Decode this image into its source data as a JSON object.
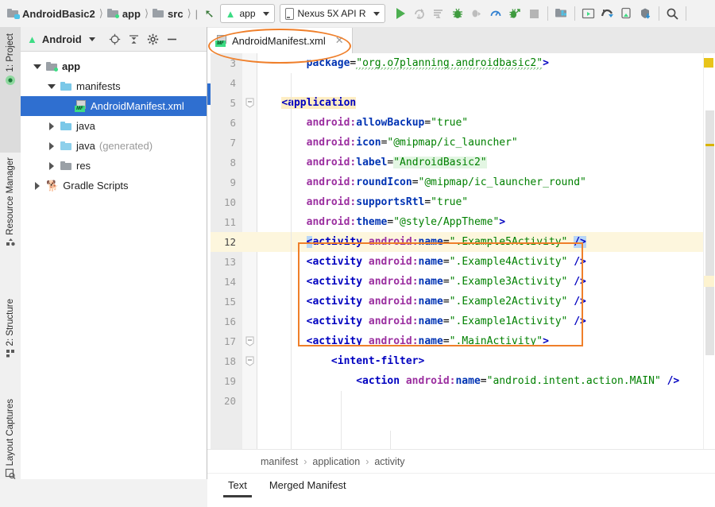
{
  "window": {
    "app": "Android Studio",
    "breadcrumb": [
      {
        "label": "AndroidBasic2",
        "icon": "project-folder-icon"
      },
      {
        "label": "app",
        "icon": "module-folder-icon"
      },
      {
        "label": "src",
        "icon": "folder-icon"
      }
    ]
  },
  "toolbar": {
    "build_icon": "hammer-icon",
    "run_config": {
      "label": "app",
      "icon": "android-head-icon",
      "caret": "chevron-down-icon"
    },
    "device": {
      "label": "Nexus 5X API R",
      "icon": "phone-icon",
      "caret": "chevron-down-icon"
    },
    "actions": [
      {
        "name": "run-button",
        "icon": "play-icon"
      },
      {
        "name": "apply-changes-button",
        "icon": "apply-changes-icon"
      },
      {
        "name": "apply-code-changes-button",
        "icon": "apply-code-changes-icon"
      },
      {
        "name": "debug-button",
        "icon": "bug-icon"
      },
      {
        "name": "attach-debugger-button",
        "icon": "attach-debugger-icon"
      },
      {
        "name": "profile-button",
        "icon": "gauge-icon"
      },
      {
        "name": "run-with-coverage-button",
        "icon": "bug-run-icon"
      },
      {
        "name": "stop-button",
        "icon": "stop-icon"
      },
      {
        "name": "sync-gradle-button",
        "icon": "gradle-sync-icon"
      },
      {
        "name": "avd-manager-button",
        "icon": "avd-manager-icon"
      },
      {
        "name": "sdk-manager-button",
        "icon": "sdk-manager-icon"
      },
      {
        "name": "layout-inspector-button",
        "icon": "device-file-explorer-icon"
      },
      {
        "name": "device-manager-button",
        "icon": "device-download-icon"
      },
      {
        "name": "search-everywhere-button",
        "icon": "search-icon"
      }
    ]
  },
  "left_strip": {
    "items": [
      {
        "label": "1: Project",
        "icon": "project-icon",
        "selected": true
      },
      {
        "label": "Resource Manager",
        "icon": "resource-manager-icon",
        "selected": false
      },
      {
        "label": "2: Structure",
        "icon": "structure-icon",
        "selected": false
      },
      {
        "label": "Layout Captures",
        "icon": "layout-captures-icon",
        "selected": false
      }
    ]
  },
  "project_panel": {
    "title": "Android",
    "title_icon": "android-head-icon",
    "caret": "chevron-down-icon",
    "tools": [
      {
        "name": "select-opened-file-button",
        "icon": "target-icon"
      },
      {
        "name": "collapse-all-button",
        "icon": "collapse-all-icon"
      },
      {
        "name": "settings-button",
        "icon": "gear-icon"
      },
      {
        "name": "hide-button",
        "icon": "minus-icon"
      }
    ],
    "tree": [
      {
        "label": "app",
        "indent": 0,
        "twist": "open",
        "icon": "module-folder-icon",
        "bold": true,
        "selected": false,
        "suffix": ""
      },
      {
        "label": "manifests",
        "indent": 1,
        "twist": "open",
        "icon": "folder-blue-icon",
        "bold": false,
        "selected": false,
        "suffix": ""
      },
      {
        "label": "AndroidManifest.xml",
        "indent": 2,
        "twist": "none",
        "icon": "manifest-file-icon",
        "bold": false,
        "selected": true,
        "suffix": ""
      },
      {
        "label": "java",
        "indent": 1,
        "twist": "closed",
        "icon": "folder-blue-icon",
        "bold": false,
        "selected": false,
        "suffix": ""
      },
      {
        "label": "java",
        "indent": 1,
        "twist": "closed",
        "icon": "folder-generated-icon",
        "bold": false,
        "selected": false,
        "suffix": "(generated)"
      },
      {
        "label": "res",
        "indent": 1,
        "twist": "closed",
        "icon": "folder-res-icon",
        "bold": false,
        "selected": false,
        "suffix": ""
      },
      {
        "label": "Gradle Scripts",
        "indent": 0,
        "twist": "closed",
        "icon": "gradle-elephant-icon",
        "bold": false,
        "selected": false,
        "suffix": ""
      }
    ]
  },
  "editor": {
    "tab": {
      "label": "AndroidManifest.xml",
      "icon": "manifest-file-icon",
      "close": "close-icon"
    },
    "first_line": 3,
    "current_line": 12,
    "lines": [
      {
        "n": 3,
        "fold": "none",
        "tokens": [
          {
            "t": "        ",
            "c": "plain"
          },
          {
            "t": "package",
            "c": "attr"
          },
          {
            "t": "=",
            "c": "eq"
          },
          {
            "t": "\"org.o7planning.androidbasic2\"",
            "c": "str-squiggle"
          },
          {
            "t": ">",
            "c": "tag"
          }
        ]
      },
      {
        "n": 4,
        "fold": "none",
        "tokens": []
      },
      {
        "n": 5,
        "fold": "minus",
        "tokens": [
          {
            "t": "    ",
            "c": "plain"
          },
          {
            "t": "<application",
            "c": "tag-hl"
          }
        ]
      },
      {
        "n": 6,
        "fold": "none",
        "tokens": [
          {
            "t": "        ",
            "c": "plain"
          },
          {
            "t": "android:",
            "c": "ns"
          },
          {
            "t": "allowBackup",
            "c": "attr"
          },
          {
            "t": "=",
            "c": "eq"
          },
          {
            "t": "\"true\"",
            "c": "str"
          }
        ]
      },
      {
        "n": 7,
        "fold": "none",
        "tokens": [
          {
            "t": "        ",
            "c": "plain"
          },
          {
            "t": "android:",
            "c": "ns"
          },
          {
            "t": "icon",
            "c": "attr"
          },
          {
            "t": "=",
            "c": "eq"
          },
          {
            "t": "\"@mipmap/ic_launcher\"",
            "c": "str"
          }
        ]
      },
      {
        "n": 8,
        "fold": "none",
        "tokens": [
          {
            "t": "        ",
            "c": "plain"
          },
          {
            "t": "android:",
            "c": "ns"
          },
          {
            "t": "label",
            "c": "attr"
          },
          {
            "t": "=",
            "c": "eq"
          },
          {
            "t": "\"AndroidBasic2\"",
            "c": "str-hl"
          }
        ]
      },
      {
        "n": 9,
        "fold": "none",
        "tokens": [
          {
            "t": "        ",
            "c": "plain"
          },
          {
            "t": "android:",
            "c": "ns"
          },
          {
            "t": "roundIcon",
            "c": "attr"
          },
          {
            "t": "=",
            "c": "eq"
          },
          {
            "t": "\"@mipmap/ic_launcher_round\"",
            "c": "str"
          }
        ]
      },
      {
        "n": 10,
        "fold": "none",
        "tokens": [
          {
            "t": "        ",
            "c": "plain"
          },
          {
            "t": "android:",
            "c": "ns"
          },
          {
            "t": "supportsRtl",
            "c": "attr"
          },
          {
            "t": "=",
            "c": "eq"
          },
          {
            "t": "\"true\"",
            "c": "str"
          }
        ]
      },
      {
        "n": 11,
        "fold": "none",
        "tokens": [
          {
            "t": "        ",
            "c": "plain"
          },
          {
            "t": "android:",
            "c": "ns"
          },
          {
            "t": "theme",
            "c": "attr"
          },
          {
            "t": "=",
            "c": "eq"
          },
          {
            "t": "\"@style/AppTheme\"",
            "c": "str"
          },
          {
            "t": ">",
            "c": "tag"
          }
        ]
      },
      {
        "n": 12,
        "fold": "none",
        "tokens": [
          {
            "t": "        ",
            "c": "plain"
          },
          {
            "t": "<",
            "c": "brace"
          },
          {
            "t": "activity ",
            "c": "tag"
          },
          {
            "t": "android:",
            "c": "ns"
          },
          {
            "t": "name",
            "c": "attr"
          },
          {
            "t": "=",
            "c": "eq"
          },
          {
            "t": "\".Example5Activity\"",
            "c": "str"
          },
          {
            "t": " ",
            "c": "plain"
          },
          {
            "t": "/>",
            "c": "brace"
          }
        ]
      },
      {
        "n": 13,
        "fold": "none",
        "tokens": [
          {
            "t": "        ",
            "c": "plain"
          },
          {
            "t": "<activity ",
            "c": "tag"
          },
          {
            "t": "android:",
            "c": "ns"
          },
          {
            "t": "name",
            "c": "attr"
          },
          {
            "t": "=",
            "c": "eq"
          },
          {
            "t": "\".Example4Activity\"",
            "c": "str"
          },
          {
            "t": " ",
            "c": "plain"
          },
          {
            "t": "/>",
            "c": "tag"
          }
        ]
      },
      {
        "n": 14,
        "fold": "none",
        "tokens": [
          {
            "t": "        ",
            "c": "plain"
          },
          {
            "t": "<activity ",
            "c": "tag"
          },
          {
            "t": "android:",
            "c": "ns"
          },
          {
            "t": "name",
            "c": "attr"
          },
          {
            "t": "=",
            "c": "eq"
          },
          {
            "t": "\".Example3Activity\"",
            "c": "str"
          },
          {
            "t": " ",
            "c": "plain"
          },
          {
            "t": "/>",
            "c": "tag"
          }
        ]
      },
      {
        "n": 15,
        "fold": "none",
        "tokens": [
          {
            "t": "        ",
            "c": "plain"
          },
          {
            "t": "<activity ",
            "c": "tag"
          },
          {
            "t": "android:",
            "c": "ns"
          },
          {
            "t": "name",
            "c": "attr"
          },
          {
            "t": "=",
            "c": "eq"
          },
          {
            "t": "\".Example2Activity\"",
            "c": "str"
          },
          {
            "t": " ",
            "c": "plain"
          },
          {
            "t": "/>",
            "c": "tag"
          }
        ]
      },
      {
        "n": 16,
        "fold": "none",
        "tokens": [
          {
            "t": "        ",
            "c": "plain"
          },
          {
            "t": "<activity ",
            "c": "tag"
          },
          {
            "t": "android:",
            "c": "ns"
          },
          {
            "t": "name",
            "c": "attr"
          },
          {
            "t": "=",
            "c": "eq"
          },
          {
            "t": "\".Example1Activity\"",
            "c": "str"
          },
          {
            "t": " ",
            "c": "plain"
          },
          {
            "t": "/>",
            "c": "tag"
          }
        ]
      },
      {
        "n": 17,
        "fold": "minus",
        "tokens": [
          {
            "t": "        ",
            "c": "plain"
          },
          {
            "t": "<activity ",
            "c": "tag"
          },
          {
            "t": "android:",
            "c": "ns"
          },
          {
            "t": "name",
            "c": "attr"
          },
          {
            "t": "=",
            "c": "eq"
          },
          {
            "t": "\".MainActivity\"",
            "c": "str"
          },
          {
            "t": ">",
            "c": "tag"
          }
        ]
      },
      {
        "n": 18,
        "fold": "minus",
        "tokens": [
          {
            "t": "            ",
            "c": "plain"
          },
          {
            "t": "<intent-filter>",
            "c": "tag"
          }
        ]
      },
      {
        "n": 19,
        "fold": "none",
        "tokens": [
          {
            "t": "                ",
            "c": "plain"
          },
          {
            "t": "<action ",
            "c": "tag"
          },
          {
            "t": "android:",
            "c": "ns"
          },
          {
            "t": "name",
            "c": "attr"
          },
          {
            "t": "=",
            "c": "eq"
          },
          {
            "t": "\"android.intent.action.MAIN\"",
            "c": "str"
          },
          {
            "t": " ",
            "c": "plain"
          },
          {
            "t": "/>",
            "c": "tag"
          }
        ]
      },
      {
        "n": 20,
        "fold": "none",
        "tokens": []
      }
    ],
    "breadcrumb": [
      "manifest",
      "application",
      "activity"
    ],
    "bottom_tabs": [
      {
        "label": "Text",
        "active": true
      },
      {
        "label": "Merged Manifest",
        "active": false
      }
    ]
  },
  "annotations": [
    {
      "name": "tab-highlight-ellipse",
      "shape": "ellipse",
      "color": "#ef7f2a"
    },
    {
      "name": "activity-lines-rectangle",
      "shape": "rect",
      "color": "#ef7f2a"
    }
  ]
}
